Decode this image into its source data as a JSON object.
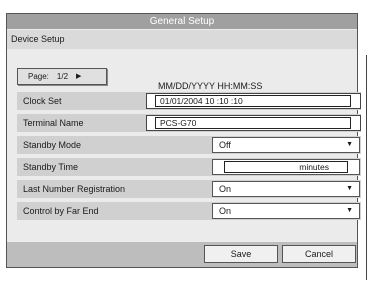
{
  "window": {
    "title": "General Setup"
  },
  "section": {
    "title": "Device Setup"
  },
  "pager": {
    "label": "Page:",
    "value": "1/2"
  },
  "format_hint": "MM/DD/YYYY HH:MM:SS",
  "fields": {
    "clock_set": {
      "label": "Clock Set",
      "value": "01/01/2004 10 :10 :10"
    },
    "terminal_name": {
      "label": "Terminal Name",
      "value": "PCS-G70"
    },
    "standby_mode": {
      "label": "Standby Mode",
      "value": "Off"
    },
    "standby_time": {
      "label": "Standby Time",
      "value": "minutes"
    },
    "last_number_registration": {
      "label": "Last Number Registration",
      "value": "On"
    },
    "control_by_far_end": {
      "label": "Control by Far End",
      "value": "On"
    }
  },
  "buttons": {
    "save": "Save",
    "cancel": "Cancel"
  }
}
